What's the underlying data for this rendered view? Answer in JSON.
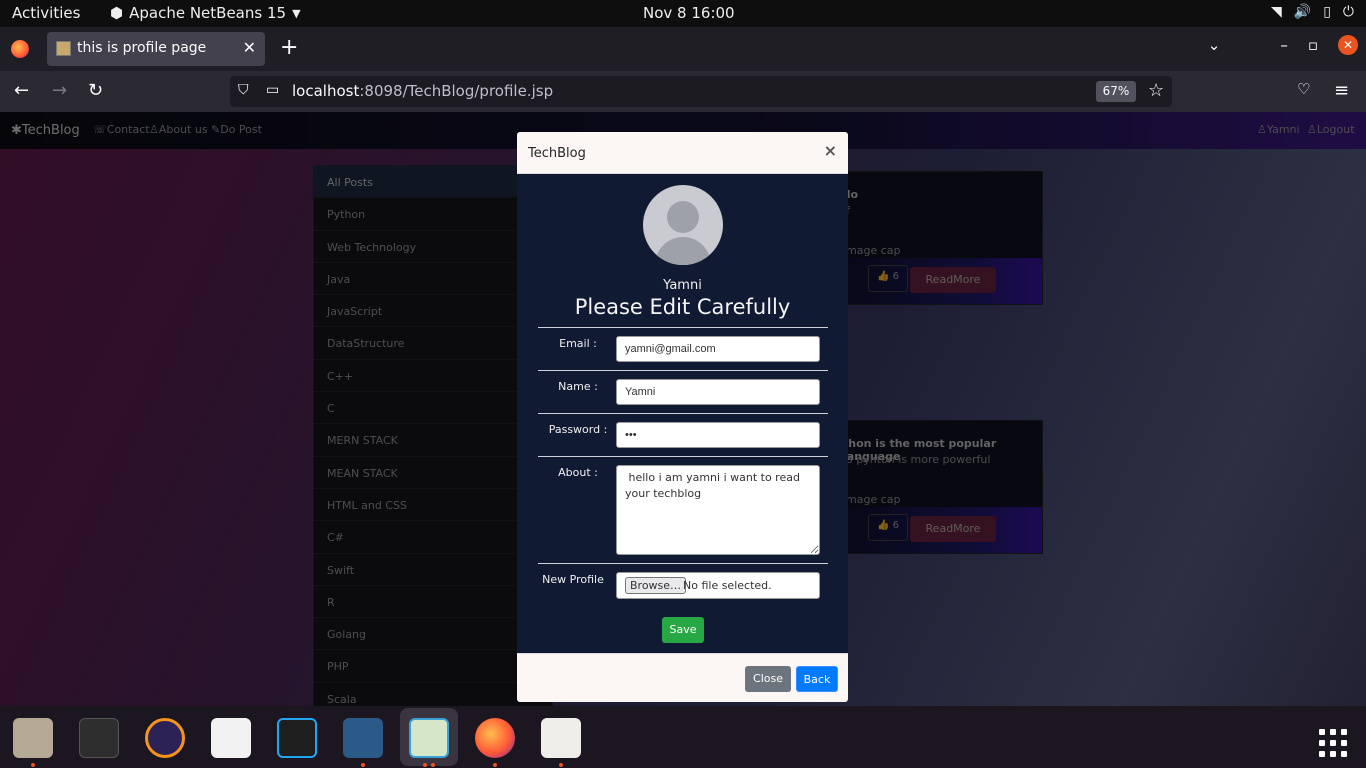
{
  "topbar": {
    "activities": "Activities",
    "app_name": "Apache NetBeans 15",
    "clock": "Nov 8  16:00"
  },
  "browser": {
    "tab_title": "this is profile page",
    "url_host": "localhost",
    "url_rest": ":8098/TechBlog/profile.jsp",
    "zoom": "67%"
  },
  "site": {
    "brand": "TechBlog",
    "nav_links": [
      "Contact",
      "About us",
      "Do Post"
    ],
    "user": "Yamni",
    "logout": "Logout"
  },
  "categories": [
    "All Posts",
    "Python",
    "Web Technology",
    "Java",
    "JavaScript",
    "DataStructure",
    "C++",
    "C",
    "MERN STACK",
    "MEAN STACK",
    "HTML and CSS",
    "C#",
    "Swift",
    "R",
    "Golang",
    "PHP",
    "Scala"
  ],
  "cards": [
    {
      "title": "llo",
      "body": "lf",
      "cap": "image cap",
      "likes": "6",
      "readmore": "ReadMore"
    },
    {
      "title": "thon is the most popular language",
      "body": "lo pyhton is more powerful",
      "cap": "image cap",
      "likes": "6",
      "readmore": "ReadMore"
    }
  ],
  "modal": {
    "title": "TechBlog",
    "close_x": "×",
    "username": "Yamni",
    "heading": "Please Edit Carefully",
    "email_label": "Email :",
    "email_value": "yamni@gmail.com",
    "name_label": "Name :",
    "name_value": "Yamni",
    "password_label": "Password :",
    "password_value": "•••",
    "about_label": "About :",
    "about_value": " hello i am yamni i want to read your techblog",
    "profile_label": "New Profile",
    "browse_label": "Browse…",
    "no_file": "No file selected.",
    "save": "Save",
    "close": "Close",
    "back": "Back"
  },
  "dock": {
    "apps": [
      "files-icon",
      "terminal-icon",
      "eclipse-icon",
      "text-editor-icon",
      "vscode-icon",
      "mysql-workbench-icon",
      "netbeans-icon",
      "firefox-icon",
      "document-viewer-icon"
    ]
  }
}
